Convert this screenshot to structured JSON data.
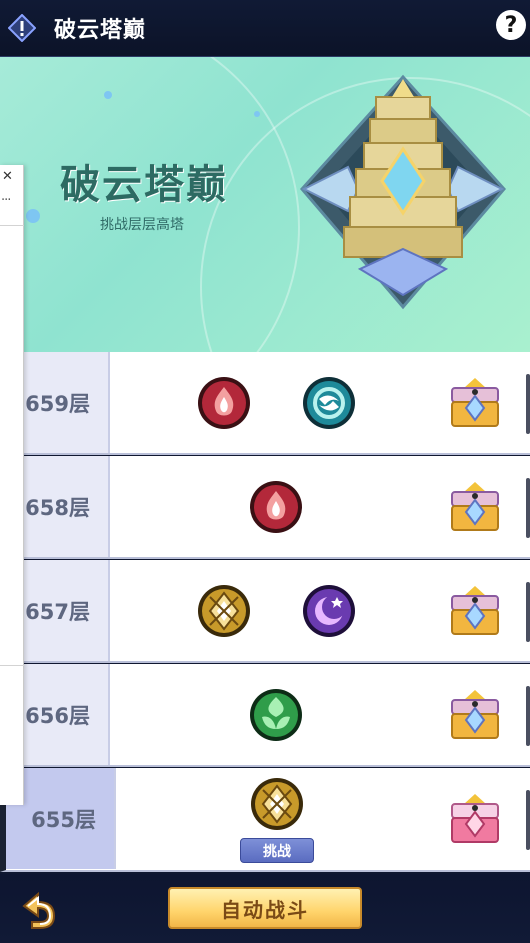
{
  "header": {
    "title": "破云塔巅",
    "help_glyph": "?"
  },
  "banner": {
    "title": "破云塔巅",
    "subtitle": "挑战层层高塔"
  },
  "floors": [
    {
      "label": "659层",
      "elements": [
        "pyro",
        "anemo"
      ],
      "chest": "gold"
    },
    {
      "label": "658层",
      "elements": [
        "pyro"
      ],
      "chest": "gold"
    },
    {
      "label": "657层",
      "elements": [
        "geo",
        "electro"
      ],
      "chest": "gold"
    },
    {
      "label": "656层",
      "elements": [
        "dendro"
      ],
      "chest": "gold"
    },
    {
      "label": "655层",
      "elements": [
        "geo"
      ],
      "chest": "pink",
      "active": true,
      "challenge_label": "挑战"
    }
  ],
  "footer": {
    "auto_battle_label": "自动战斗"
  },
  "colors": {
    "pyro": "#b3283a",
    "anemo": "#1e8a9a",
    "geo": "#c89a2a",
    "electro": "#6a3bb0",
    "dendro": "#2f9d4a",
    "accent": "#ffd46b"
  }
}
